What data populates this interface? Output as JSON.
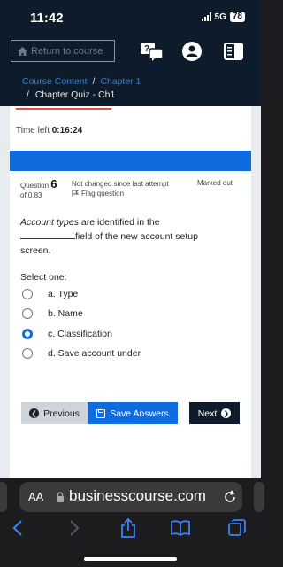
{
  "status_bar": {
    "time": "11:42",
    "network": "5G",
    "battery": "78"
  },
  "header": {
    "return_label": "Return to course",
    "icons": [
      "home-icon",
      "chat-help-icon",
      "user-icon",
      "sidebar-toggle-icon"
    ]
  },
  "breadcrumb": {
    "course_content": "Course Content",
    "separator": "/",
    "chapter": "Chapter 1",
    "quiz": "Chapter Quiz - Ch1"
  },
  "quiz": {
    "time_left_label": "Time left",
    "time_left_value": "0:16:24",
    "question_label": "Question",
    "question_number": "6",
    "points": "of 0.83",
    "state": "Not changed since last attempt",
    "flag_label": "Flag question",
    "marked": "Marked out",
    "question_term": "Account types",
    "question_part1": "are identified in the",
    "question_part2": "field of the new account setup",
    "question_part3": "screen.",
    "select_one": "Select one:",
    "options": [
      {
        "label": "a. Type",
        "selected": false
      },
      {
        "label": "b. Name",
        "selected": false
      },
      {
        "label": "c. Classification",
        "selected": true
      },
      {
        "label": "d. Save account under",
        "selected": false
      }
    ],
    "prev_label": "Previous",
    "save_label": "Save Answers",
    "next_label": "Next"
  },
  "browser": {
    "aa_label": "AA",
    "url": "businesscourse.com"
  },
  "colors": {
    "primary": "#0f6cde",
    "dark_header": "#0d1b2a",
    "link": "#3d7bc7"
  }
}
